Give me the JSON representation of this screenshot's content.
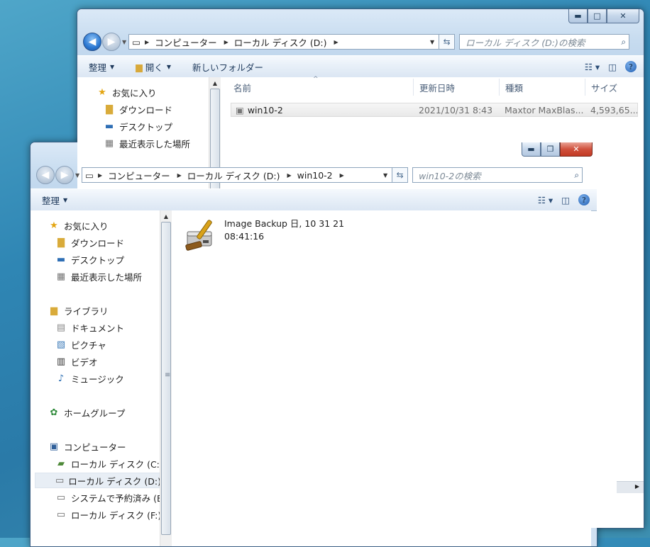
{
  "back_window": {
    "address": {
      "seg1": "コンピューター",
      "seg2": "ローカル ディスク (D:)"
    },
    "search_placeholder": "ローカル ディスク (D:)の検索",
    "toolbar": {
      "organize": "整理",
      "open": "開く",
      "new_folder": "新しいフォルダー"
    },
    "nav": [
      {
        "label": "お気に入り",
        "icon": "star-icon"
      },
      {
        "label": "ダウンロード",
        "icon": "download-folder-icon"
      },
      {
        "label": "デスクトップ",
        "icon": "desktop-icon"
      },
      {
        "label": "最近表示した場所",
        "icon": "recent-places-icon"
      }
    ],
    "columns": {
      "name": "名前",
      "date": "更新日時",
      "type": "種類",
      "size": "サイズ"
    },
    "files": [
      {
        "name": "win10-2",
        "date": "2021/10/31 8:43",
        "type": "Maxtor MaxBlas...",
        "size": "4,593,65..."
      }
    ]
  },
  "front_window": {
    "address": {
      "seg1": "コンピューター",
      "seg2": "ローカル ディスク (D:)",
      "seg3": "win10-2"
    },
    "search_placeholder": "win10-2の検索",
    "toolbar": {
      "organize": "整理"
    },
    "nav": {
      "favorites": [
        {
          "label": "お気に入り",
          "icon": "star-icon"
        },
        {
          "label": "ダウンロード",
          "icon": "download-folder-icon"
        },
        {
          "label": "デスクトップ",
          "icon": "desktop-icon"
        },
        {
          "label": "最近表示した場所",
          "icon": "recent-places-icon"
        }
      ],
      "libraries": [
        {
          "label": "ライブラリ",
          "icon": "library-icon"
        },
        {
          "label": "ドキュメント",
          "icon": "document-icon"
        },
        {
          "label": "ピクチャ",
          "icon": "picture-icon"
        },
        {
          "label": "ビデオ",
          "icon": "video-icon"
        },
        {
          "label": "ミュージック",
          "icon": "music-icon"
        }
      ],
      "homegroup": [
        {
          "label": "ホームグループ",
          "icon": "homegroup-icon"
        }
      ],
      "computer": [
        {
          "label": "コンピューター",
          "icon": "computer-icon"
        },
        {
          "label": "ローカル ディスク (C:)",
          "icon": "windows-drive-icon"
        },
        {
          "label": "ローカル ディスク (D:)",
          "icon": "drive-icon"
        },
        {
          "label": "システムで予約済み (E",
          "icon": "drive-icon"
        },
        {
          "label": "ローカル ディスク (F:)",
          "icon": "drive-icon"
        }
      ]
    },
    "file": {
      "name_line1": "Image Backup 日, 10 31 21",
      "name_line2": "08:41:16",
      "icon": "backup-image-icon"
    }
  },
  "colors": {
    "accent": "#2a78d2",
    "close_red": "#c23a24",
    "desktop": "#2f86b4"
  }
}
